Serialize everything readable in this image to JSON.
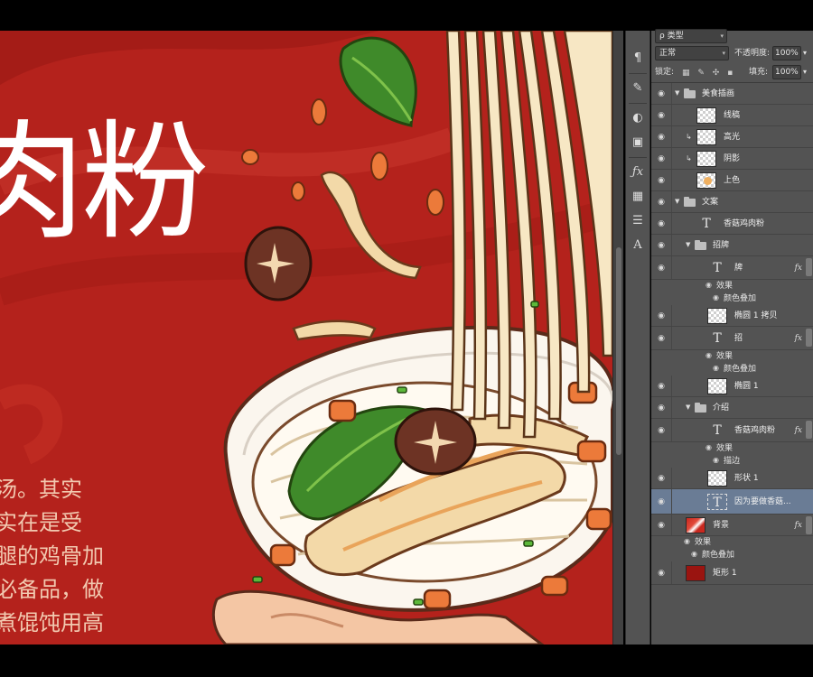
{
  "canvas": {
    "title_text": "肉粉",
    "body_lines": [
      "汤。其实",
      "实在是受",
      "腿的鸡骨加",
      "必备品，做",
      "煮馄饨用高"
    ],
    "colors": {
      "background": "#b4221c",
      "title": "#ffffff",
      "body": "#f2c9b0"
    }
  },
  "tools": [
    "paragraph-icon",
    "brush-presets-icon",
    "adjustments-icon",
    "styles-icon",
    "fx-icon",
    "grid-icon",
    "channels-icon",
    "character-icon"
  ],
  "layers_panel": {
    "top_dropdown": "ρ 类型",
    "blend_mode": "正常",
    "opacity_label": "不透明度:",
    "opacity_value": "100%",
    "lock_label": "锁定:",
    "fill_label": "填充:",
    "fill_value": "100%",
    "items": [
      {
        "kind": "group",
        "name": "美食插画"
      },
      {
        "kind": "pixel",
        "name": "线稿"
      },
      {
        "kind": "pixel",
        "name": "高光",
        "clipped": true
      },
      {
        "kind": "pixel",
        "name": "阴影",
        "clipped": true
      },
      {
        "kind": "pixel",
        "name": "上色"
      },
      {
        "kind": "group",
        "name": "文案"
      },
      {
        "kind": "text",
        "name": "香菇鸡肉粉"
      },
      {
        "kind": "group",
        "name": "招牌"
      },
      {
        "kind": "text",
        "name": "牌",
        "fx": "fx"
      },
      {
        "kind": "effect",
        "name": "效果"
      },
      {
        "kind": "effect",
        "name": "颜色叠加"
      },
      {
        "kind": "shape",
        "name": "椭圆 1 拷贝"
      },
      {
        "kind": "text",
        "name": "招",
        "fx": "fx"
      },
      {
        "kind": "effect",
        "name": "效果"
      },
      {
        "kind": "effect",
        "name": "颜色叠加"
      },
      {
        "kind": "shape",
        "name": "椭圆 1"
      },
      {
        "kind": "group",
        "name": "介绍"
      },
      {
        "kind": "text",
        "name": "香菇鸡肉粉",
        "fx": "fx"
      },
      {
        "kind": "effect",
        "name": "效果"
      },
      {
        "kind": "effect",
        "name": "描边"
      },
      {
        "kind": "shape",
        "name": "形状 1"
      },
      {
        "kind": "text",
        "name": "因为要做香菇...",
        "selected": true
      },
      {
        "kind": "pixel",
        "name": "背景",
        "fx": "fx"
      },
      {
        "kind": "effect",
        "name": "效果"
      },
      {
        "kind": "effect",
        "name": "颜色叠加"
      },
      {
        "kind": "shape",
        "name": "矩形 1"
      }
    ]
  }
}
